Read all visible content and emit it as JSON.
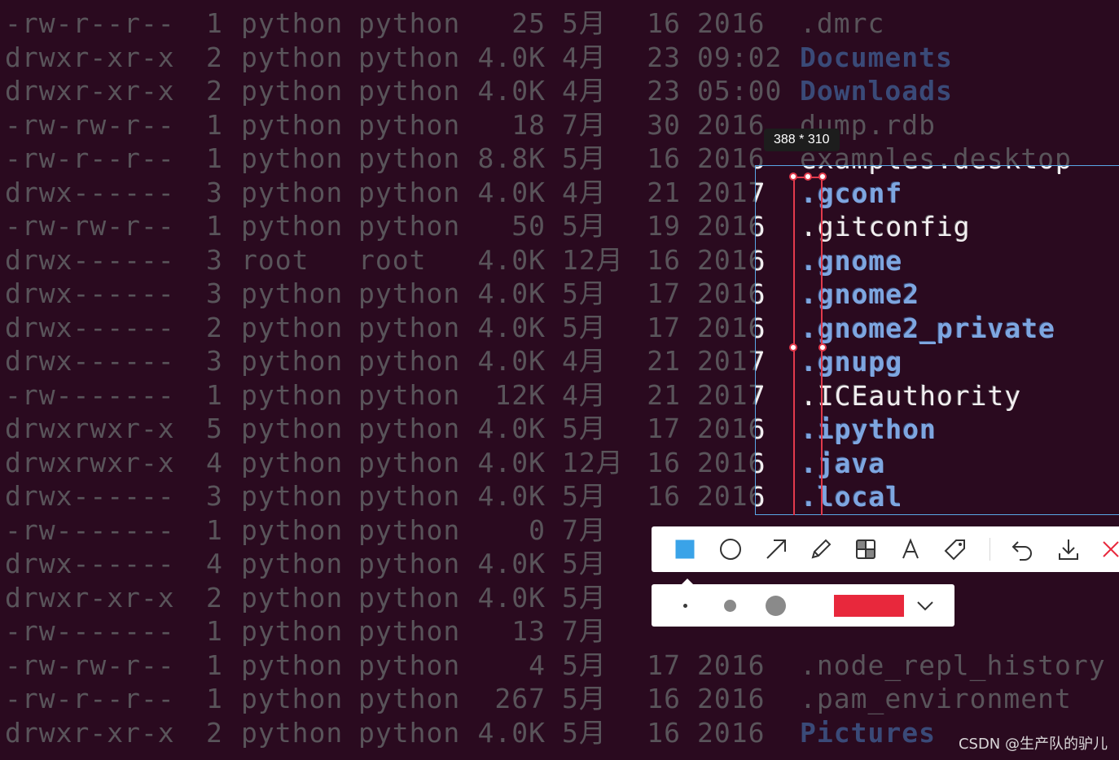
{
  "terminal": {
    "rows": [
      {
        "perm": "-rw-r--r--",
        "links": "1",
        "owner": "python",
        "group": "python",
        "size": "25",
        "month": "5月",
        "day": "16",
        "time": "2016",
        "name": ".dmrc",
        "dir": false
      },
      {
        "perm": "drwxr-xr-x",
        "links": "2",
        "owner": "python",
        "group": "python",
        "size": "4.0K",
        "month": "4月",
        "day": "23",
        "time": "09:02",
        "name": "Documents",
        "dir": true
      },
      {
        "perm": "drwxr-xr-x",
        "links": "2",
        "owner": "python",
        "group": "python",
        "size": "4.0K",
        "month": "4月",
        "day": "23",
        "time": "05:00",
        "name": "Downloads",
        "dir": true
      },
      {
        "perm": "-rw-rw-r--",
        "links": "1",
        "owner": "python",
        "group": "python",
        "size": "18",
        "month": "7月",
        "day": "30",
        "time": "2016",
        "name": "dump.rdb",
        "dir": false
      },
      {
        "perm": "-rw-r--r--",
        "links": "1",
        "owner": "python",
        "group": "python",
        "size": "8.8K",
        "month": "5月",
        "day": "16",
        "time": "2016",
        "name": "examples.desktop",
        "dir": false
      },
      {
        "perm": "drwx------",
        "links": "3",
        "owner": "python",
        "group": "python",
        "size": "4.0K",
        "month": "4月",
        "day": "21",
        "time": "2017",
        "name": ".gconf",
        "dir": true
      },
      {
        "perm": "-rw-rw-r--",
        "links": "1",
        "owner": "python",
        "group": "python",
        "size": "50",
        "month": "5月",
        "day": "19",
        "time": "2016",
        "name": ".gitconfig",
        "dir": false
      },
      {
        "perm": "drwx------",
        "links": "3",
        "owner": "root",
        "group": "root",
        "size": "4.0K",
        "month": "12月",
        "day": "16",
        "time": "2016",
        "name": ".gnome",
        "dir": true
      },
      {
        "perm": "drwx------",
        "links": "3",
        "owner": "python",
        "group": "python",
        "size": "4.0K",
        "month": "5月",
        "day": "17",
        "time": "2016",
        "name": ".gnome2",
        "dir": true
      },
      {
        "perm": "drwx------",
        "links": "2",
        "owner": "python",
        "group": "python",
        "size": "4.0K",
        "month": "5月",
        "day": "17",
        "time": "2016",
        "name": ".gnome2_private",
        "dir": true
      },
      {
        "perm": "drwx------",
        "links": "3",
        "owner": "python",
        "group": "python",
        "size": "4.0K",
        "month": "4月",
        "day": "21",
        "time": "2017",
        "name": ".gnupg",
        "dir": true
      },
      {
        "perm": "-rw-------",
        "links": "1",
        "owner": "python",
        "group": "python",
        "size": "12K",
        "month": "4月",
        "day": "21",
        "time": "2017",
        "name": ".ICEauthority",
        "dir": false
      },
      {
        "perm": "drwxrwxr-x",
        "links": "5",
        "owner": "python",
        "group": "python",
        "size": "4.0K",
        "month": "5月",
        "day": "17",
        "time": "2016",
        "name": ".ipython",
        "dir": true
      },
      {
        "perm": "drwxrwxr-x",
        "links": "4",
        "owner": "python",
        "group": "python",
        "size": "4.0K",
        "month": "12月",
        "day": "16",
        "time": "2016",
        "name": ".java",
        "dir": true
      },
      {
        "perm": "drwx------",
        "links": "3",
        "owner": "python",
        "group": "python",
        "size": "4.0K",
        "month": "5月",
        "day": "16",
        "time": "2016",
        "name": ".local",
        "dir": true
      },
      {
        "perm": "-rw-------",
        "links": "1",
        "owner": "python",
        "group": "python",
        "size": "0",
        "month": "7月",
        "day": "",
        "time": "",
        "name": "",
        "dir": false
      },
      {
        "perm": "drwx------",
        "links": "4",
        "owner": "python",
        "group": "python",
        "size": "4.0K",
        "month": "5月",
        "day": "",
        "time": "",
        "name": "",
        "dir": false
      },
      {
        "perm": "drwxr-xr-x",
        "links": "2",
        "owner": "python",
        "group": "python",
        "size": "4.0K",
        "month": "5月",
        "day": "",
        "time": "",
        "name": "",
        "dir": false
      },
      {
        "perm": "-rw-------",
        "links": "1",
        "owner": "python",
        "group": "python",
        "size": "13",
        "month": "7月",
        "day": "",
        "time": "",
        "name": "",
        "dir": false
      },
      {
        "perm": "-rw-rw-r--",
        "links": "1",
        "owner": "python",
        "group": "python",
        "size": "4",
        "month": "5月",
        "day": "17",
        "time": "2016",
        "name": ".node_repl_history",
        "dir": false
      },
      {
        "perm": "-rw-r--r--",
        "links": "1",
        "owner": "python",
        "group": "python",
        "size": "267",
        "month": "5月",
        "day": "16",
        "time": "2016",
        "name": ".pam_environment",
        "dir": false
      },
      {
        "perm": "drwxr-xr-x",
        "links": "2",
        "owner": "python",
        "group": "python",
        "size": "4.0K",
        "month": "5月",
        "day": "16",
        "time": "2016",
        "name": "Pictures",
        "dir": true
      }
    ]
  },
  "capture": {
    "size_label": "388 * 310"
  },
  "toolbar": {
    "tools": [
      "rectangle-icon",
      "ellipse-icon",
      "arrow-icon",
      "pen-icon",
      "mosaic-icon",
      "text-icon",
      "tag-icon",
      "undo-icon",
      "download-icon",
      "close-icon"
    ],
    "active_color": "#e8283c",
    "accent": "#3aa3e8"
  },
  "watermark": "CSDN @生产队的驴儿"
}
